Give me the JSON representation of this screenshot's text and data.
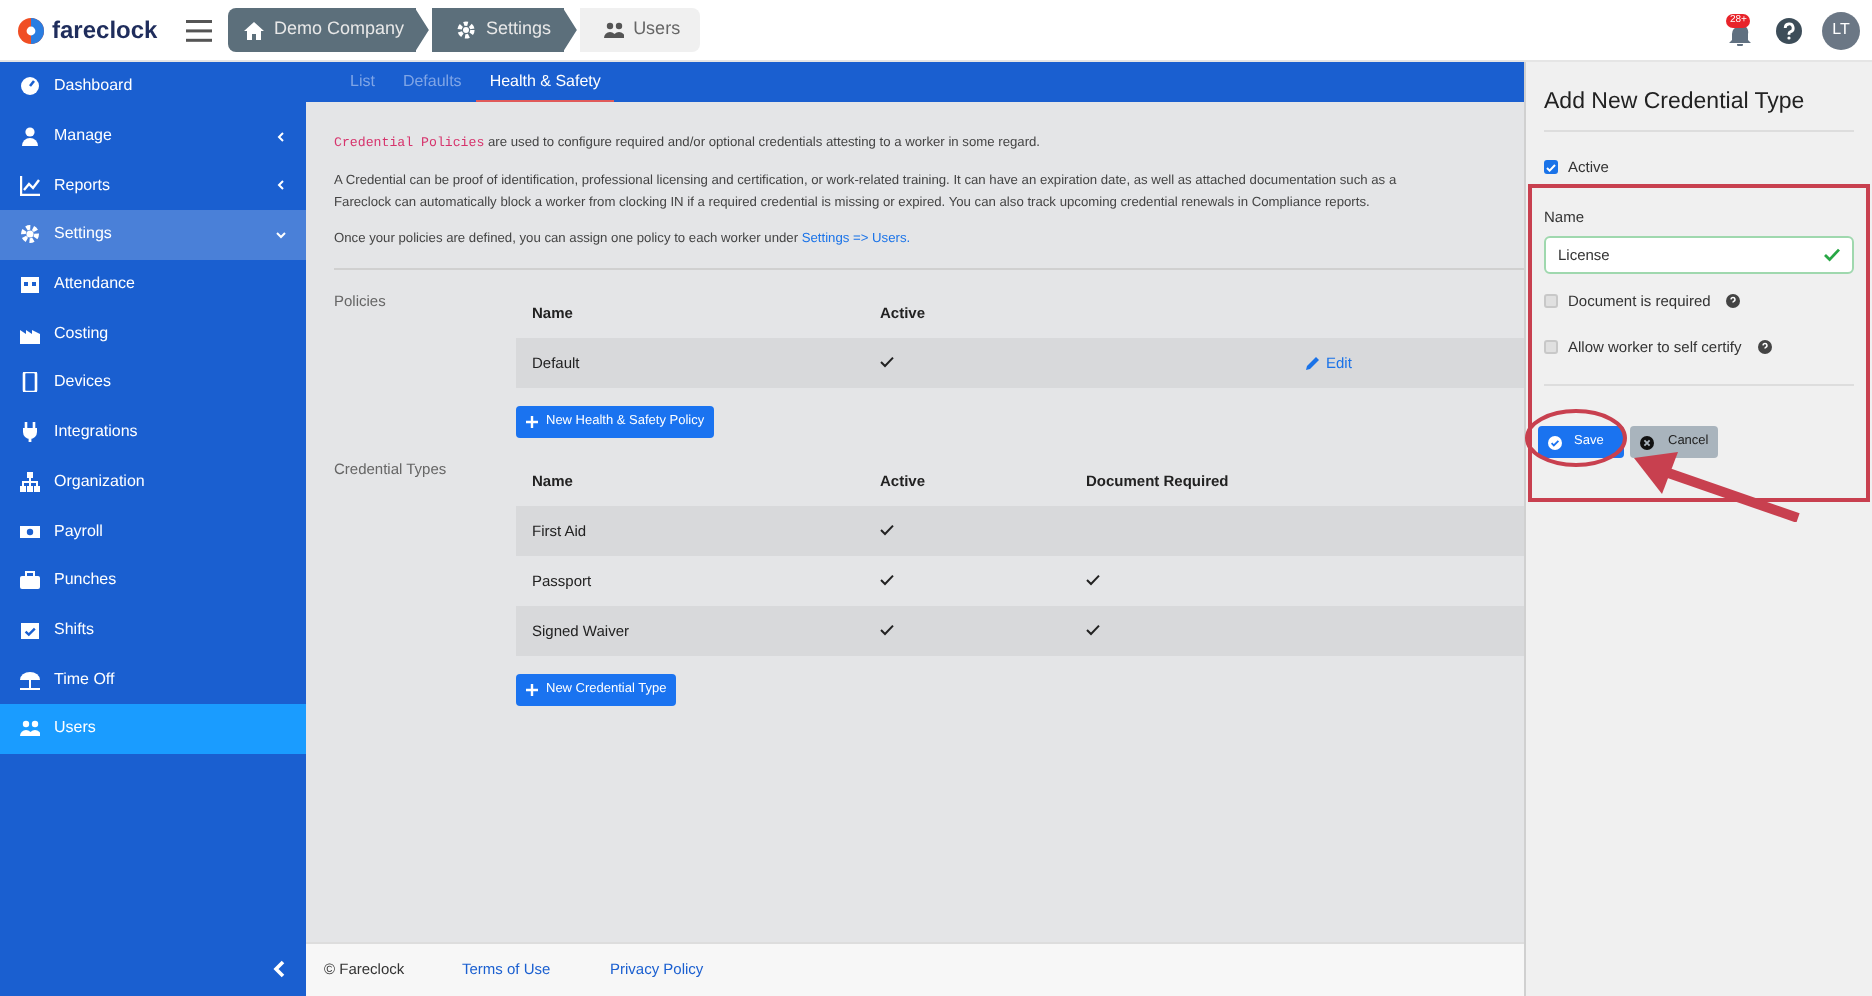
{
  "header": {
    "logo": "fareclock",
    "breadcrumbs": [
      "Demo Company",
      "Settings",
      "Users"
    ],
    "notification_badge": "28+",
    "avatar": "LT"
  },
  "sidebar": {
    "items": [
      {
        "label": "Dashboard",
        "kind": "link",
        "selected": false
      },
      {
        "label": "Manage",
        "kind": "group",
        "expanded": false,
        "selected": false
      },
      {
        "label": "Reports",
        "kind": "group",
        "expanded": false,
        "selected": false
      },
      {
        "label": "Settings",
        "kind": "group",
        "expanded": true,
        "selected": false
      },
      {
        "label": "Attendance",
        "kind": "link",
        "selected": false
      },
      {
        "label": "Costing",
        "kind": "link",
        "selected": false
      },
      {
        "label": "Devices",
        "kind": "link",
        "selected": false
      },
      {
        "label": "Integrations",
        "kind": "link",
        "selected": false
      },
      {
        "label": "Organization",
        "kind": "link",
        "selected": false
      },
      {
        "label": "Payroll",
        "kind": "link",
        "selected": false
      },
      {
        "label": "Punches",
        "kind": "link",
        "selected": false
      },
      {
        "label": "Shifts",
        "kind": "link",
        "selected": false
      },
      {
        "label": "Time Off",
        "kind": "link",
        "selected": false
      },
      {
        "label": "Users",
        "kind": "link",
        "selected": true
      }
    ]
  },
  "tabs": [
    {
      "label": "List",
      "selected": false
    },
    {
      "label": "Defaults",
      "selected": false
    },
    {
      "label": "Health & Safety",
      "selected": true
    }
  ],
  "intro": {
    "code_term": "Credential Policies",
    "sentence": "are used to configure required and/or optional credentials attesting to a worker in some regard.",
    "paragraph_lines": [
      "A Credential can be proof of identification, professional licensing and certification, or work-related training. It can have an expiration date, as well as attached documentation such as a",
      "Fareclock can automatically block a worker from clocking IN if a required credential is missing or expired. You can also track upcoming credential renewals in Compliance reports."
    ],
    "assign_text": "Once your policies are defined, you can assign one policy to each worker under",
    "assign_link": "Settings => Users."
  },
  "policies": {
    "title": "Policies",
    "columns": [
      "Name",
      "Active"
    ],
    "rows": [
      {
        "name": "Default",
        "active": true,
        "action": "Edit"
      }
    ],
    "add_button": "New Health & Safety Policy"
  },
  "credential_types": {
    "title": "Credential Types",
    "columns": [
      "Name",
      "Active",
      "Document Required"
    ],
    "rows": [
      {
        "name": "First Aid",
        "active": true,
        "document_required": false
      },
      {
        "name": "Passport",
        "active": true,
        "document_required": true
      },
      {
        "name": "Signed Waiver",
        "active": true,
        "document_required": true
      }
    ],
    "add_button": "New Credential Type"
  },
  "panel": {
    "title": "Add New Credential Type",
    "active": {
      "label": "Active",
      "checked": true
    },
    "name_label": "Name",
    "name_value": "License",
    "name_valid": true,
    "options": [
      {
        "label": "Document is required",
        "checked": false
      },
      {
        "label": "Allow worker to self certify",
        "checked": false
      }
    ],
    "save": "Save",
    "cancel": "Cancel"
  },
  "footer": {
    "copyright": "© Fareclock",
    "links": [
      "Terms of Use",
      "Privacy Policy"
    ]
  }
}
